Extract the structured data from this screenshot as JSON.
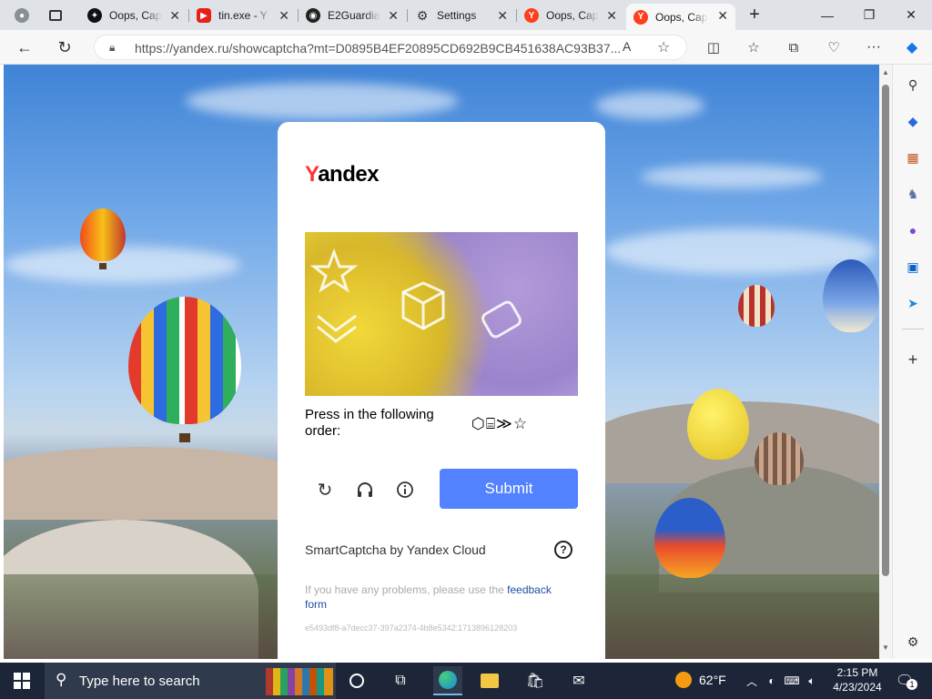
{
  "tabs": [
    {
      "title": "Oops, Cap",
      "icon": "oops-icon"
    },
    {
      "title": "tin.exe - Y",
      "icon": "youtube-icon"
    },
    {
      "title": "E2Guardia",
      "icon": "github-icon"
    },
    {
      "title": "Settings",
      "icon": "gear-icon"
    },
    {
      "title": "Oops, Cap",
      "icon": "yandex-icon"
    },
    {
      "title": "Oops, Cap",
      "icon": "yandex-icon"
    }
  ],
  "address": {
    "url": "https://yandex.ru/showcaptcha?mt=D0895B4EF20895CD692B9CB451638AC93B37..."
  },
  "captcha": {
    "logo_y": "Y",
    "logo_rest": "andex",
    "instruction": "Press in the following order:",
    "order_symbols": "⬡⌸≫☆",
    "submit_label": "Submit",
    "byline": "SmartCaptcha by Yandex Cloud",
    "help_symbol": "?",
    "problem_text": "If you have any problems, please use the",
    "feedback_link": "feedback form",
    "hash": "e5493df8-a7decc37-397a2374-4b8e5342:1713896128203"
  },
  "taskbar": {
    "search_placeholder": "Type here to search",
    "weather": "62°F",
    "time": "2:15 PM",
    "date": "4/23/2024",
    "notifications": "1"
  },
  "colors": {
    "accent": "#5282ff",
    "yandex_red": "#ff3333"
  }
}
